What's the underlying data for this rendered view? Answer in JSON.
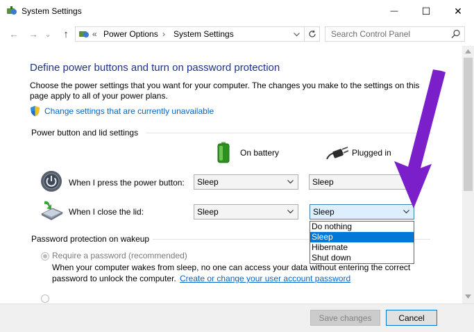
{
  "window": {
    "title": "System Settings",
    "minimize_glyph": "—",
    "maximize_glyph": "☐",
    "close_glyph": "✕"
  },
  "nav": {
    "back_glyph": "←",
    "forward_glyph": "→",
    "recent_glyph": "⌄",
    "up_glyph": "↑"
  },
  "address": {
    "chevrons": "«",
    "crumbs": [
      "Power Options",
      "System Settings"
    ],
    "separator": "›"
  },
  "search": {
    "placeholder": "Search Control Panel"
  },
  "page": {
    "heading": "Define power buttons and turn on password protection",
    "description": "Choose the power settings that you want for your computer. The changes you make to the settings on this page apply to all of your power plans.",
    "change_link": "Change settings that are currently unavailable"
  },
  "power_section": {
    "title": "Power button and lid settings",
    "col_battery": "On battery",
    "col_plugged": "Plugged in",
    "rows": [
      {
        "label": "When I press the power button:",
        "battery": "Sleep",
        "plugged": "Sleep"
      },
      {
        "label": "When I close the lid:",
        "battery": "Sleep",
        "plugged": "Sleep"
      }
    ],
    "dropdown_options": [
      "Do nothing",
      "Sleep",
      "Hibernate",
      "Shut down"
    ],
    "dropdown_selected": "Sleep"
  },
  "password_section": {
    "title": "Password protection on wakeup",
    "option1_label": "Require a password (recommended)",
    "option1_desc_a": "When your computer wakes from sleep, no one can access your data without entering the correct",
    "option1_desc_b": "password to unlock the computer.",
    "option1_link": "Create or change your user account password"
  },
  "footer": {
    "save_label": "Save changes",
    "cancel_label": "Cancel"
  },
  "colors": {
    "heading": "#1e3287",
    "link": "#0066cc",
    "annotation_arrow": "#7a1fc9",
    "selection": "#0078d7"
  }
}
